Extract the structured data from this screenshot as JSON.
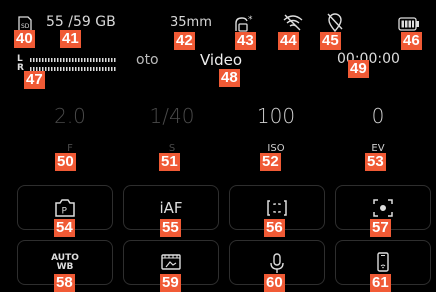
{
  "status": {
    "storage": "55 /59 GB",
    "focal": "35mm",
    "timecode": "00:00:00"
  },
  "modes": {
    "photo": "oto",
    "video": "Video"
  },
  "meters": {
    "left": "L",
    "right": "R"
  },
  "params": [
    {
      "value": "2.0",
      "label": "F"
    },
    {
      "value": "1/40",
      "label": "S"
    },
    {
      "value": "100",
      "label": "ISO"
    },
    {
      "value": "0",
      "label": "EV"
    }
  ],
  "tiles": {
    "iaf": "iAF",
    "auto_wb_line1": "AUTO",
    "auto_wb_line2": "WB"
  },
  "badges": [
    "40",
    "41",
    "42",
    "43",
    "44",
    "45",
    "46",
    "47",
    "48",
    "49",
    "50",
    "51",
    "52",
    "53",
    "54",
    "55",
    "56",
    "57",
    "58",
    "59",
    "60",
    "61"
  ],
  "colors": {
    "badge": "#f05a35",
    "background": "#000000",
    "tile_border": "#2e2e2e"
  }
}
